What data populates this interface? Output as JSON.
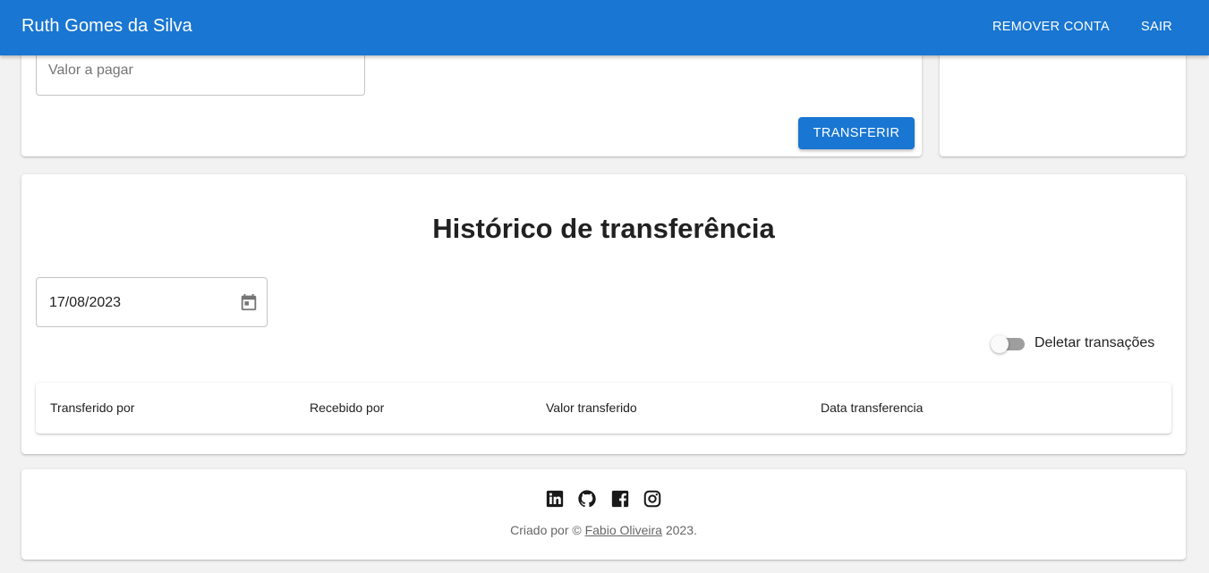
{
  "header": {
    "user_name": "Ruth Gomes da Silva",
    "remove_account_label": "REMOVER CONTA",
    "logout_label": "SAIR",
    "color": "#1976d2"
  },
  "transfer": {
    "amount_placeholder": "Valor a pagar",
    "submit_label": "TRANSFERIR"
  },
  "history": {
    "title": "Histórico de transferência",
    "date_value": "17/08/2023",
    "date_icon": "calendar-icon",
    "delete_toggle_label": "Deletar transações",
    "delete_toggle_on": false,
    "columns": [
      "Transferido por",
      "Recebido por",
      "Valor transferido",
      "Data transferencia"
    ]
  },
  "footer": {
    "social_icons": [
      "linkedin-icon",
      "github-icon",
      "facebook-icon",
      "instagram-icon"
    ],
    "credit_prefix": "Criado por ©",
    "author": "Fabio Oliveira",
    "year_suffix": "2023."
  }
}
